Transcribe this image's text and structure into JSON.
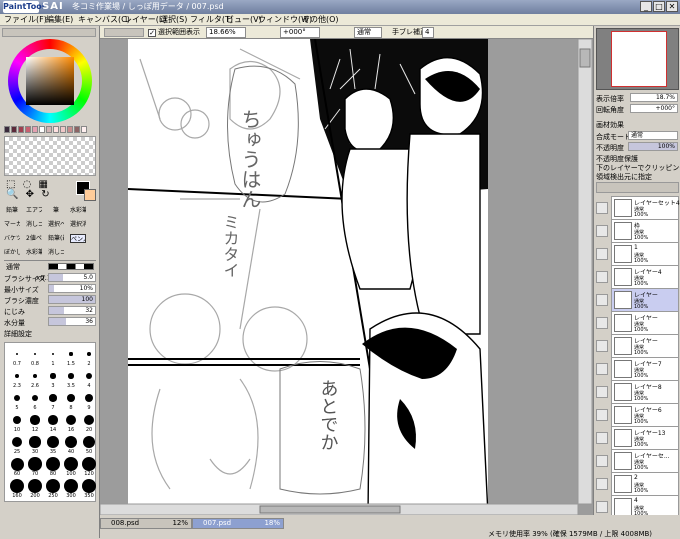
{
  "window": {
    "logo": "PaintTool",
    "brand": "SAI",
    "title": "冬コミ作業場 / しっぽ用データ / 007.psd",
    "min": "_",
    "max": "□",
    "close": "✕"
  },
  "menu": [
    "ファイル(F)",
    "編集(E)",
    "キャンバス(C)",
    "レイヤー(L)",
    "選択(S)",
    "フィルタ(T)",
    "ビュー(V)",
    "ウィンドウ(W)",
    "その他(O)"
  ],
  "toolbar": {
    "selection_checkbox_label": "選択範囲表示",
    "zoom": "18.66%",
    "rotation": "+000°",
    "blend": "通常",
    "stabilizer_label": "手ブレ補正",
    "stabilizer_value": "4"
  },
  "color": {
    "primary": "#000000",
    "secondary": "#ffcc99",
    "swatches": [
      "#3a2a3c",
      "#5c2a3a",
      "#a04050",
      "#c86070",
      "#e4a0b0",
      "#ffffff",
      "#d2b4b4",
      "#ffe0e0",
      "#f0c8c8",
      "#c88c8c",
      "#8c6464",
      "#fff0f0"
    ]
  },
  "tools": {
    "row1": [
      "鉛筆",
      "エアブラシ",
      "筆",
      "水彩筆"
    ],
    "row2": [
      "マーカー",
      "消しゴム",
      "選択ペン",
      "選択消し"
    ],
    "row3": [
      "バケツ",
      "2値ペン",
      "鉛筆(最)",
      "ペン入力"
    ],
    "row4": [
      "ぼかし",
      "水彩筆",
      "消しゴム"
    ]
  },
  "brush": {
    "mode": "通常",
    "size_label": "ブラシサイズ",
    "size_mult": "x0.1",
    "size_value": "5.0",
    "min_size_label": "最小サイズ",
    "min_size_value": "10%",
    "density_label": "ブラシ濃度",
    "density_value": "100",
    "blend_label": "にじみ",
    "blend_value": "32",
    "dilution_label": "水分量",
    "dilution_value": "36",
    "detail_label": "詳細設定",
    "size_presets": [
      "0.7",
      "0.8",
      "1",
      "1.5",
      "2",
      "2.3",
      "2.6",
      "3",
      "3.5",
      "4",
      "5",
      "6",
      "7",
      "8",
      "9",
      "10",
      "12",
      "14",
      "16",
      "20",
      "25",
      "30",
      "35",
      "40",
      "50",
      "60",
      "70",
      "80",
      "100",
      "120",
      "160",
      "200",
      "250",
      "300",
      "350"
    ]
  },
  "navigator": {
    "zoom_label": "表示倍率",
    "zoom_value": "18.7%",
    "rotate_label": "回転角度",
    "rotate_value": "+000°"
  },
  "layer_panel": {
    "effect_label": "画材効果",
    "blend_label": "合成モード",
    "blend_value": "通常",
    "opacity_label": "不透明度",
    "opacity_value": "100%",
    "opt1": "不透明度保護",
    "opt2": "下のレイヤーでクリッピング",
    "opt3": "領域検出元に指定"
  },
  "layers": [
    {
      "name": "レイヤーセット4",
      "mode": "通常",
      "opacity": "100%"
    },
    {
      "name": "枠",
      "mode": "通常",
      "opacity": "100%"
    },
    {
      "name": "1",
      "mode": "通常",
      "opacity": "100%"
    },
    {
      "name": "レイヤー4",
      "mode": "通常",
      "opacity": "100%"
    },
    {
      "name": "レイヤー",
      "mode": "通常",
      "opacity": "100%"
    },
    {
      "name": "レイヤー",
      "mode": "通常",
      "opacity": "100%"
    },
    {
      "name": "レイヤー",
      "mode": "通常",
      "opacity": "100%"
    },
    {
      "name": "レイヤー7",
      "mode": "通常",
      "opacity": "100%"
    },
    {
      "name": "レイヤー8",
      "mode": "通常",
      "opacity": "100%"
    },
    {
      "name": "レイヤー6",
      "mode": "通常",
      "opacity": "100%"
    },
    {
      "name": "レイヤー13",
      "mode": "通常",
      "opacity": "100%"
    },
    {
      "name": "レイヤーセ...",
      "mode": "通常",
      "opacity": "100%"
    },
    {
      "name": "2",
      "mode": "通常",
      "opacity": "100%"
    },
    {
      "name": "4",
      "mode": "通常",
      "opacity": "100%"
    }
  ],
  "documents": [
    {
      "name": "008.psd",
      "zoom": "12%"
    },
    {
      "name": "007.psd",
      "zoom": "18%"
    }
  ],
  "status": "メモリ使用率 39% (確保 1579MB / 上限 4008MB)",
  "canvas_text": {
    "bubble1": "ちゅうはん",
    "bubble2": "ミカタイ",
    "bubble3": "あとでか"
  }
}
